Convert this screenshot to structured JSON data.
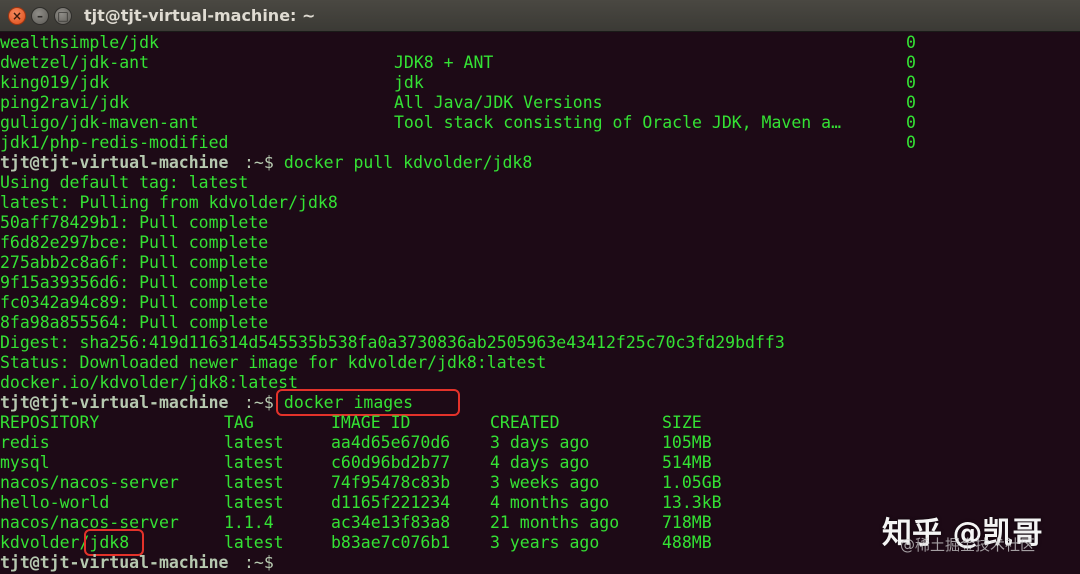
{
  "window": {
    "title": "tjt@tjt-virtual-machine: ~",
    "close_glyph": "×",
    "min_glyph": "–",
    "max_glyph": "□"
  },
  "search_rows": [
    {
      "name": "wealthsimple/jdk",
      "desc": "",
      "stars": "0"
    },
    {
      "name": "dwetzel/jdk-ant",
      "desc": "JDK8 + ANT",
      "stars": "0"
    },
    {
      "name": "king019/jdk",
      "desc": "jdk",
      "stars": "0"
    },
    {
      "name": "ping2ravi/jdk",
      "desc": "All Java/JDK Versions",
      "stars": "0"
    },
    {
      "name": "guligo/jdk-maven-ant",
      "desc": "Tool stack consisting of Oracle JDK, Maven a…",
      "stars": "0"
    },
    {
      "name": "jdk1/php-redis-modified",
      "desc": "",
      "stars": "0"
    }
  ],
  "prompt": {
    "user": "tjt@tjt-virtual-machine",
    "path": ":~$"
  },
  "pull_command": " docker pull kdvolder/jdk8",
  "pull_output": [
    "Using default tag: latest",
    "latest: Pulling from kdvolder/jdk8",
    "50aff78429b1: Pull complete",
    "f6d82e297bce: Pull complete",
    "275abb2c8a6f: Pull complete",
    "9f15a39356d6: Pull complete",
    "fc0342a94c89: Pull complete",
    "8fa98a855564: Pull complete",
    "Digest: sha256:419d116314d545535b538fa0a3730836ab2505963e43412f25c70c3fd29bdff3",
    "Status: Downloaded newer image for kdvolder/jdk8:latest",
    "docker.io/kdvolder/jdk8:latest"
  ],
  "images_command": " docker images",
  "images_table": {
    "headers": [
      "REPOSITORY",
      "TAG",
      "IMAGE ID",
      "CREATED",
      "SIZE"
    ],
    "rows": [
      [
        "redis",
        "latest",
        "aa4d65e670d6",
        "3 days ago",
        "105MB"
      ],
      [
        "mysql",
        "latest",
        "c60d96bd2b77",
        "4 days ago",
        "514MB"
      ],
      [
        "nacos/nacos-server",
        "latest",
        "74f95478c83b",
        "3 weeks ago",
        "1.05GB"
      ],
      [
        "hello-world",
        "latest",
        "d1165f221234",
        "4 months ago",
        "13.3kB"
      ],
      [
        "nacos/nacos-server",
        "1.1.4",
        "ac34e13f83a8",
        "21 months ago",
        "718MB"
      ],
      [
        "kdvolder/jdk8",
        "latest",
        "b83ae7c076b1",
        "3 years ago",
        "488MB"
      ]
    ]
  },
  "final_prompt_tail": "",
  "watermark": {
    "main": "知乎 @凯哥",
    "sub": "@稀土掘金技术社区"
  },
  "colors": {
    "background": "#1d0a16",
    "text": "#34e234",
    "prompt": "#b6c9b0",
    "highlight_box": "#e3322a"
  }
}
